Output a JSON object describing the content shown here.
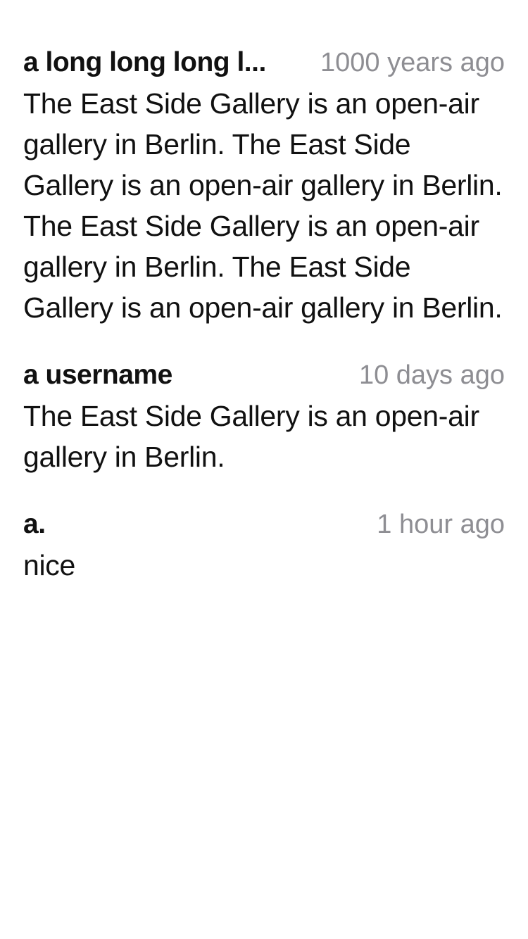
{
  "comments": [
    {
      "username": "a long long long l...",
      "timestamp": "1000 years ago",
      "body": "The East Side Gallery is an open-air gallery in Berlin. The East Side Gallery is an open-air gallery in Berlin. The East Side Gallery is an open-air gallery in Berlin. The East Side Gallery is an open-air gallery in Berlin."
    },
    {
      "username": "a username",
      "timestamp": "10 days ago",
      "body": "The East Side Gallery is an open-air gallery in Berlin."
    },
    {
      "username": "a.",
      "timestamp": "1 hour ago",
      "body": "nice"
    }
  ]
}
